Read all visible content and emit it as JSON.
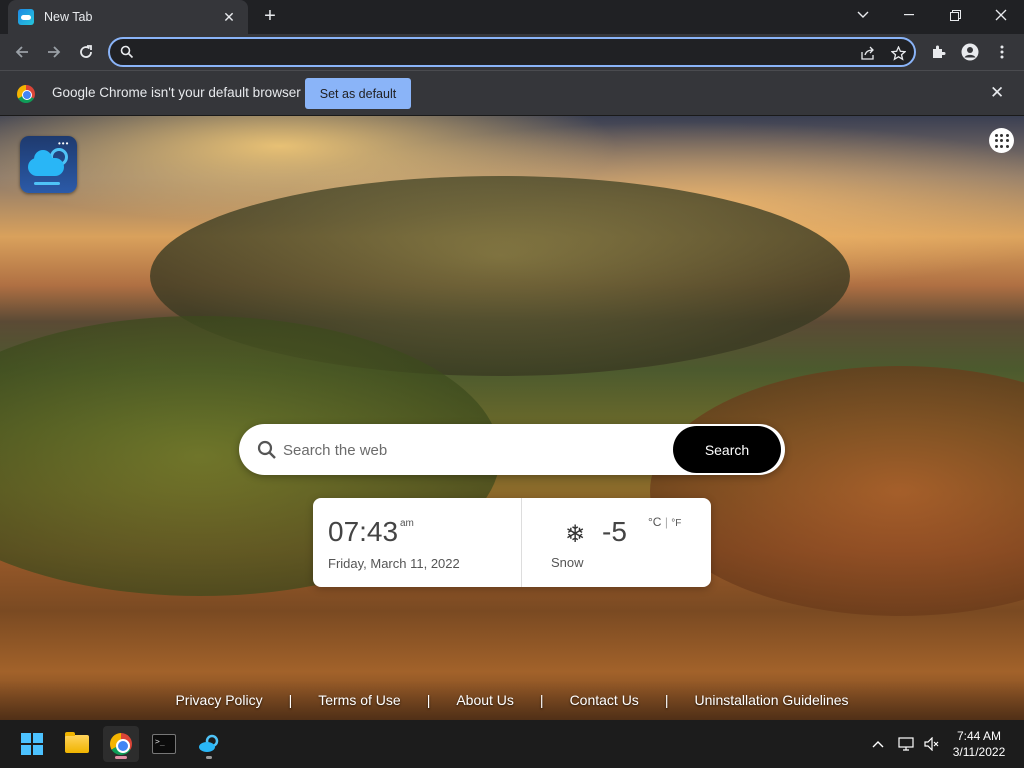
{
  "browser": {
    "tab_title": "New Tab",
    "omnibox_value": "",
    "infobar_text": "Google Chrome isn't your default browser",
    "set_default_label": "Set as default"
  },
  "page": {
    "search_placeholder": "Search the web",
    "search_button": "Search",
    "clock": {
      "time": "07:43",
      "ampm": "am",
      "date": "Friday, March 11, 2022"
    },
    "weather": {
      "icon": "snowflake-icon",
      "temp": "-5",
      "unit_c": "°C",
      "unit_sep": "|",
      "unit_f": "°F",
      "description": "Snow"
    },
    "footer_links": [
      "Privacy Policy",
      "Terms of Use",
      "About Us",
      "Contact Us",
      "Uninstallation Guidelines"
    ],
    "footer_separator": "|"
  },
  "taskbar": {
    "time": "7:44 AM",
    "date": "3/11/2022"
  },
  "colors": {
    "accent": "#8ab4f8",
    "titlebar": "#202124",
    "toolbar": "#35363a",
    "taskbar": "#1c1c1c"
  }
}
